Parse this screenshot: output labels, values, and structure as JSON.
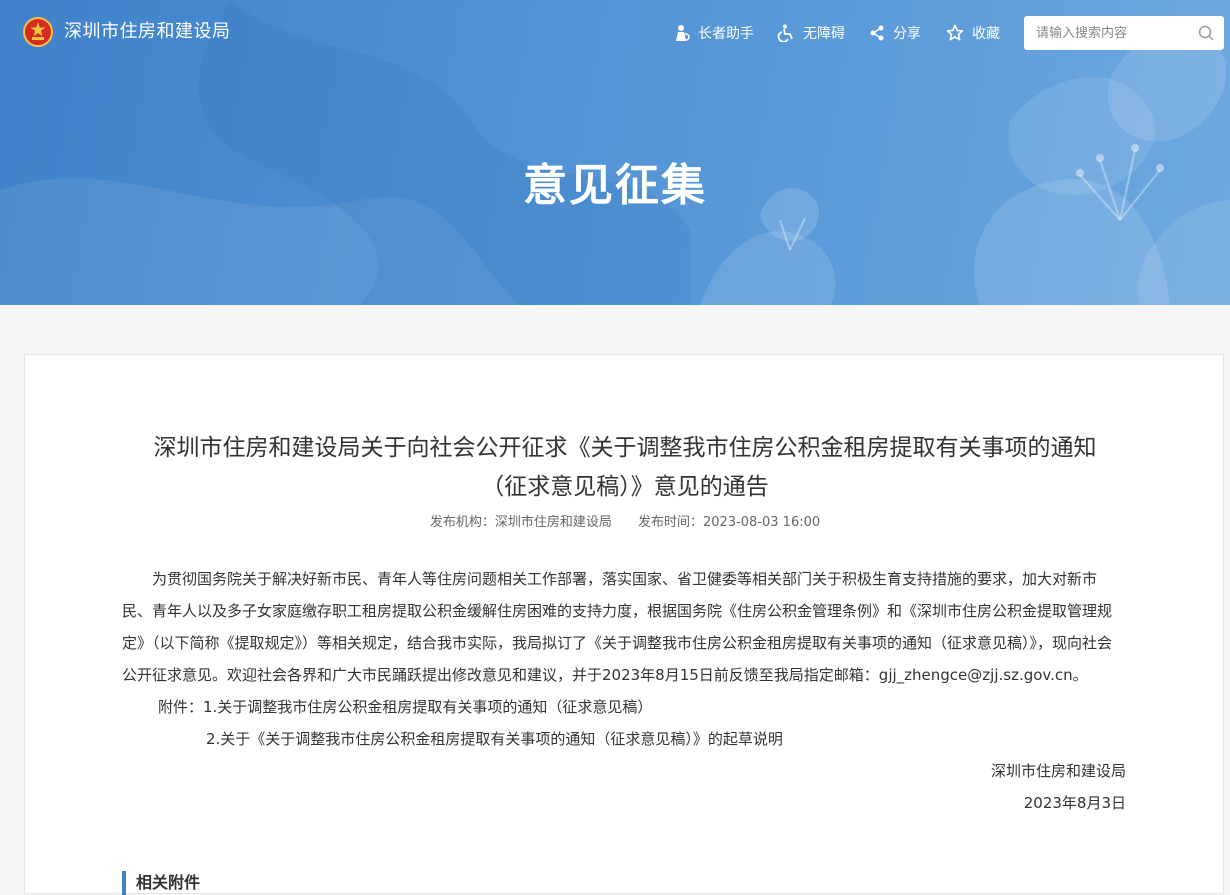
{
  "header": {
    "site_name": "深圳市住房和建设局",
    "tools": [
      {
        "label": "长者助手",
        "icon": "elder-icon"
      },
      {
        "label": "无障碍",
        "icon": "accessibility-icon"
      },
      {
        "label": "分享",
        "icon": "share-icon"
      },
      {
        "label": "收藏",
        "icon": "star-icon"
      }
    ],
    "search": {
      "placeholder": "请输入搜索内容",
      "value": ""
    }
  },
  "banner": {
    "title": "意见征集"
  },
  "article": {
    "title_line1": "深圳市住房和建设局关于向社会公开征求《关于调整我市住房公积金租房提取有关事项的通知",
    "title_line2": "（征求意见稿）》意见的通告",
    "publisher": "发布机构：深圳市住房和建设局",
    "publish_time": "发布时间：2023-08-03 16:00",
    "body": "为贯彻国务院关于解决好新市民、青年人等住房问题相关工作部署，落实国家、省卫健委等相关部门关于积极生育支持措施的要求，加大对新市民、青年人以及多子女家庭缴存职工租房提取公积金缓解住房困难的支持力度，根据国务院《住房公积金管理条例》和《深圳市住房公积金提取管理规定》（以下简称《提取规定》）等相关规定，结合我市实际，我局拟订了《关于调整我市住房公积金租房提取有关事项的通知（征求意见稿）》，现向社会公开征求意见。欢迎社会各界和广大市民踊跃提出修改意见和建议，并于2023年8月15日前反馈至我局指定邮箱：gjj_zhengce@zjj.sz.gov.cn。",
    "attachment_1": "附件：1.关于调整我市住房公积金租房提取有关事项的通知（征求意见稿）",
    "attachment_2": "2.关于《关于调整我市住房公积金租房提取有关事项的通知（征求意见稿）》的起草说明",
    "signature": "深圳市住房和建设局",
    "date": "2023年8月3日",
    "related_heading": "相关附件"
  },
  "colors": {
    "accent": "#3f82c9",
    "banner_start": "#3f82c9",
    "banner_end": "#6ea8e0"
  }
}
